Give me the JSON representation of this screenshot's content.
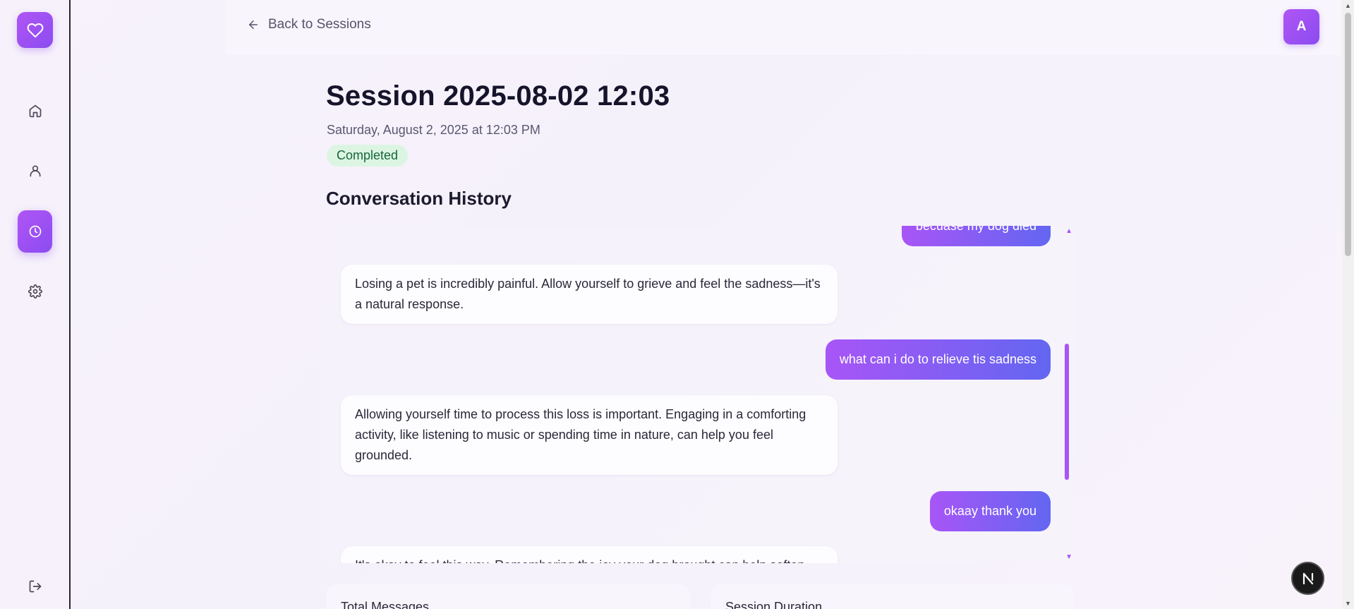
{
  "sidebar": {
    "items": [
      {
        "name": "home",
        "icon": "home-icon"
      },
      {
        "name": "profile",
        "icon": "user-icon"
      },
      {
        "name": "history",
        "icon": "clock-icon",
        "active": true
      },
      {
        "name": "settings",
        "icon": "gear-icon"
      }
    ],
    "logout_icon": "logout-icon",
    "logo_icon": "heart-icon"
  },
  "topbar": {
    "back_label": "Back to Sessions",
    "avatar_initial": "A"
  },
  "session": {
    "title": "Session 2025-08-02 12:03",
    "date": "Saturday, August 2, 2025 at 12:03 PM",
    "status": "Completed"
  },
  "conversation": {
    "title": "Conversation History",
    "messages": [
      {
        "role": "user",
        "text": "becuase my dog died"
      },
      {
        "role": "assistant",
        "text": "Losing a pet is incredibly painful. Allow yourself to grieve and feel the sadness—it's a natural response."
      },
      {
        "role": "user",
        "text": "what can i do to relieve tis sadness"
      },
      {
        "role": "assistant",
        "text": "Allowing yourself time to process this loss is important. Engaging in a comforting activity, like listening to music or spending time in nature, can help you feel grounded."
      },
      {
        "role": "user",
        "text": "okaay thank you"
      },
      {
        "role": "assistant",
        "text": "It's okay to feel this way. Remembering the joy your dog brought can help soften"
      }
    ]
  },
  "stats": {
    "messages_label": "Total Messages",
    "duration_label": "Session Duration"
  },
  "colors": {
    "accent": "#a855f7",
    "accent_end": "#6366f1",
    "status_bg": "#dcf5e3",
    "status_text": "#17663a"
  }
}
